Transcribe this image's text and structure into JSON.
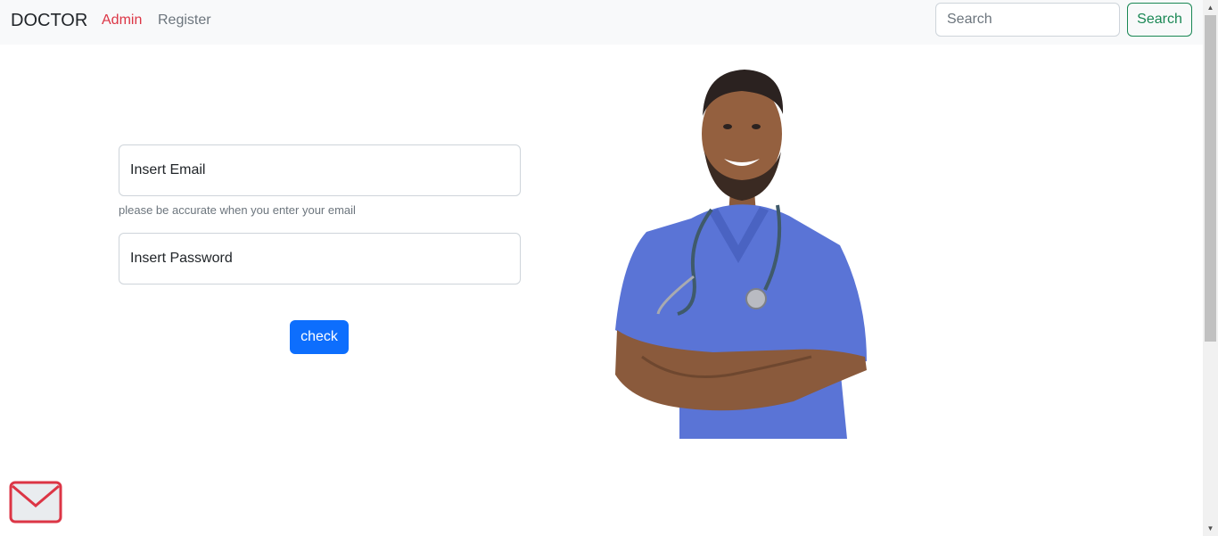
{
  "navbar": {
    "brand": "DOCTOR",
    "links": [
      {
        "label": "Admin",
        "color": "#dc3545"
      },
      {
        "label": "Register",
        "color": "#6c757d"
      }
    ],
    "search": {
      "placeholder": "Search",
      "button_label": "Search",
      "button_color": "#198754"
    }
  },
  "login_form": {
    "email_placeholder": "Insert Email",
    "email_help": "please be accurate when you enter your email",
    "password_placeholder": "Insert Password",
    "submit_label": "check",
    "submit_color": "#0d6efd"
  },
  "hero_image": {
    "icon": "doctor-photo"
  },
  "floating": {
    "icon": "mail-icon",
    "color": "#dc3545"
  },
  "scrollbar": {
    "up_icon": "▲",
    "down_icon": "▼"
  }
}
